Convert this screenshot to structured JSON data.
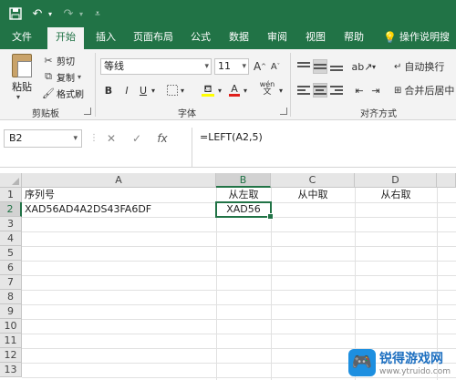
{
  "quick_access": {
    "save_icon": "save-icon",
    "undo_icon": "undo-icon",
    "redo_icon": "redo-icon",
    "customize_icon": "customize-icon"
  },
  "tabs": [
    {
      "label": "文件"
    },
    {
      "label": "开始"
    },
    {
      "label": "插入"
    },
    {
      "label": "页面布局"
    },
    {
      "label": "公式"
    },
    {
      "label": "数据"
    },
    {
      "label": "审阅"
    },
    {
      "label": "视图"
    },
    {
      "label": "帮助"
    },
    {
      "label": "操作说明搜索"
    }
  ],
  "ribbon": {
    "clipboard": {
      "paste": "粘贴",
      "cut": "剪切",
      "copy": "复制",
      "format_painter": "格式刷",
      "group": "剪贴板"
    },
    "font": {
      "font_name": "等线",
      "font_size": "11",
      "grow": "A",
      "shrink": "A",
      "bold": "B",
      "italic": "I",
      "underline": "U",
      "fill_color_letter": "A",
      "wen": "wén",
      "group": "字体"
    },
    "alignment": {
      "wrap_text": "自动换行",
      "merge_center": "合并后居中",
      "group": "对齐方式"
    }
  },
  "formula_bar": {
    "name_box": "B2",
    "formula": "=LEFT(A2,5)",
    "fx": "fx"
  },
  "sheet": {
    "columns": [
      "A",
      "B",
      "C",
      "D"
    ],
    "rows": [
      "1",
      "2",
      "3",
      "4",
      "5",
      "6",
      "7",
      "8",
      "9",
      "10",
      "11",
      "12",
      "13"
    ],
    "cells": {
      "A1": "序列号",
      "B1": "从左取",
      "C1": "从中取",
      "D1": "从右取",
      "A2": "XAD56AD4A2DS43FA6DF",
      "B2": "XAD56"
    },
    "selected_cell": "B2"
  },
  "watermark": {
    "title": "锐得游戏网",
    "url": "www.ytruido.com"
  },
  "colors": {
    "excel_green": "#217346",
    "ribbon_bg": "#f3f3f3",
    "header_bg": "#e6e6e6"
  }
}
